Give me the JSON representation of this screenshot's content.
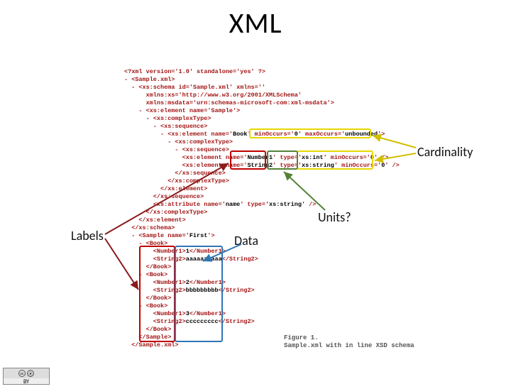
{
  "title": "XML",
  "annotations": {
    "cardinality": "Cardinality",
    "units": "Units?",
    "labels": "Labels",
    "data": "Data"
  },
  "cc": {
    "cc": "cc",
    "by_icon": "⦿",
    "by": "BY"
  },
  "caption": {
    "line1": "Figure 1.",
    "line2": "Sample.xml with in line XSD schema"
  },
  "code": {
    "l01": "<?xml version='1.0' standalone='yes' ?>",
    "l02": "- <Sample.xml>",
    "l03": "  - <xs:schema id='Sample.xml' xmlns=''",
    "l04_a": "      xmlns:xs='",
    "l04_b": "http://www.w3.org/2001/XMLSchema",
    "l04_c": "'",
    "l05": "      xmlns:msdata='urn:schemas-microsoft-com:xml-msdata'>",
    "l06": "    - <xs:element name='Sample'>",
    "l07": "      - <xs:complexType>",
    "l08": "        - <xs:sequence>",
    "l09_a": "          - <xs:element name='",
    "l09_b": "Book",
    "l09_c": "' minOccurs='",
    "l09_d": "0",
    "l09_e": "' maxOccurs='",
    "l09_f": "unbounded",
    "l09_g": "'>",
    "l10": "            - <xs:complexType>",
    "l11": "              - <xs:sequence>",
    "l12_a": "                <xs:element name='",
    "l12_b": "Number1",
    "l12_c": "' type='",
    "l12_d": "xs:int",
    "l12_e": "' minOccurs='",
    "l12_f": "0",
    "l12_g": "' />",
    "l13_a": "                <xs:element name='",
    "l13_b": "String2",
    "l13_c": "' type='",
    "l13_d": "xs:string",
    "l13_e": "' minOccurs='",
    "l13_f": "0",
    "l13_g": "' />",
    "l14": "              </xs:sequence>",
    "l15": "            </xs:complexType>",
    "l16": "          </xs:element>",
    "l17": "        </xs:sequence>",
    "l18_a": "        <xs:attribute name='",
    "l18_b": "name",
    "l18_c": "' type='",
    "l18_d": "xs:string",
    "l18_e": "' />",
    "l19": "      </xs:complexType>",
    "l20": "    </xs:element>",
    "l21": "  </xs:schema>",
    "l22_a": "  - <Sample name='",
    "l22_b": "First",
    "l22_c": "'>",
    "l23": "    - <Book>",
    "l24_a": "        <Number1>",
    "l24_b": "1",
    "l24_c": "</Number1>",
    "l25_a": "        <String2>",
    "l25_b": "aaaaaaaaaa",
    "l25_c": "</String2>",
    "l26": "      </Book>",
    "l27": "    - <Book>",
    "l28_a": "        <Number1>",
    "l28_b": "2",
    "l28_c": "</Number1>",
    "l29_a": "        <String2>",
    "l29_b": "bbbbbbbbb",
    "l29_c": "</String2>",
    "l30": "      </Book>",
    "l31": "    - <Book>",
    "l32_a": "        <Number1>",
    "l32_b": "3",
    "l32_c": "</Number1>",
    "l33_a": "        <String2>",
    "l33_b": "ccccccccc",
    "l33_c": "</String2>",
    "l34": "      </Book>",
    "l35": "    </Sample>",
    "l36": "  </Sample.xml>"
  }
}
